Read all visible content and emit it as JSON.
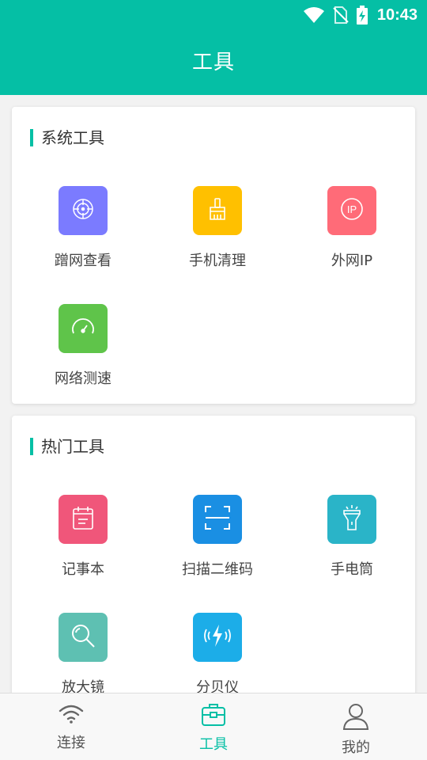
{
  "status_bar": {
    "time": "10:43"
  },
  "header": {
    "title": "工具"
  },
  "colors": {
    "accent": "#05bfa5"
  },
  "sections": [
    {
      "title": "系统工具",
      "tools": [
        {
          "label": "蹭网查看",
          "icon": "target-icon",
          "color": "#7b7bff"
        },
        {
          "label": "手机清理",
          "icon": "broom-icon",
          "color": "#ffc000"
        },
        {
          "label": "外网IP",
          "icon": "ip-icon",
          "color": "#ff6b78"
        },
        {
          "label": "网络测速",
          "icon": "speedometer-icon",
          "color": "#5fc44a"
        }
      ]
    },
    {
      "title": "热门工具",
      "tools": [
        {
          "label": "记事本",
          "icon": "notepad-icon",
          "color": "#f0567a"
        },
        {
          "label": "扫描二维码",
          "icon": "scan-icon",
          "color": "#1a8fe3"
        },
        {
          "label": "手电筒",
          "icon": "flashlight-icon",
          "color": "#2ab4c8"
        },
        {
          "label": "放大镜",
          "icon": "magnifier-icon",
          "color": "#5ec0b2"
        },
        {
          "label": "分贝仪",
          "icon": "decibel-icon",
          "color": "#1cade8"
        }
      ]
    }
  ],
  "tabbar": {
    "tabs": [
      {
        "label": "连接",
        "icon": "wifi-icon",
        "active": false
      },
      {
        "label": "工具",
        "icon": "toolbox-icon",
        "active": true
      },
      {
        "label": "我的",
        "icon": "person-icon",
        "active": false
      }
    ]
  }
}
